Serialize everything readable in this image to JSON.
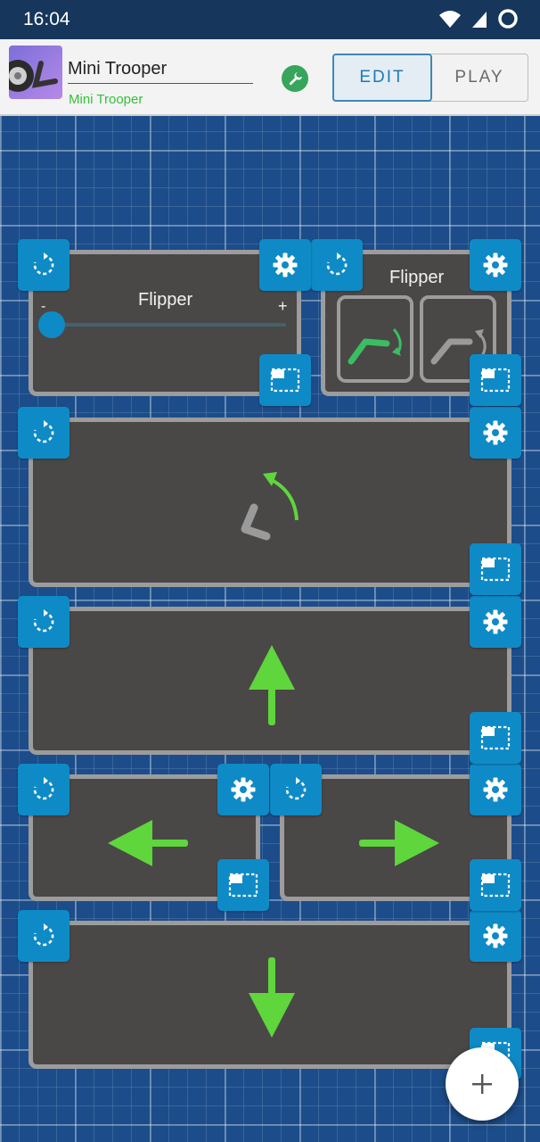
{
  "status": {
    "time": "16:04"
  },
  "header": {
    "title": "Mini Trooper",
    "subtitle": "Mini Trooper",
    "mode_edit": "EDIT",
    "mode_play": "PLAY"
  },
  "widgets": {
    "slider": {
      "title": "Flipper",
      "minus": "-",
      "plus": "+",
      "value_fraction": 0.0
    },
    "buttons": {
      "title": "Flipper"
    }
  },
  "icons": {
    "rotate": "rotate-icon",
    "settings": "gear-icon",
    "resize": "resize-icon",
    "add": "plus-icon",
    "wrench": "wrench-icon"
  },
  "colors": {
    "accent": "#0e8bc6",
    "arrow_green": "#5ed63c",
    "widget_bg": "#4a4747",
    "grid_bg": "#1c4d8a"
  }
}
